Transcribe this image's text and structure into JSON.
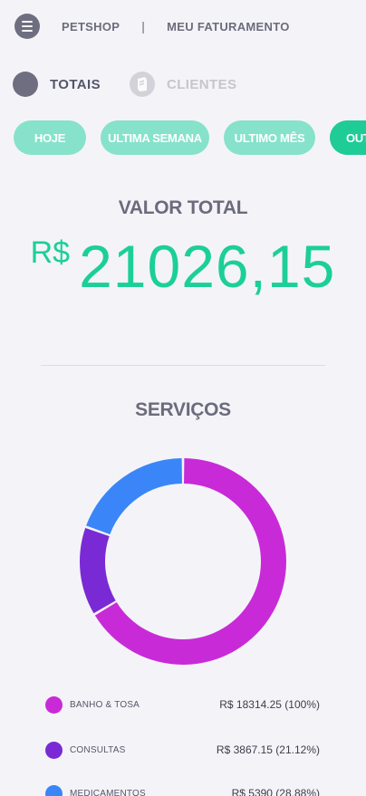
{
  "header": {
    "title": "PETSHOP",
    "separator": "|",
    "section": "MEU FATURAMENTO"
  },
  "view_toggle": {
    "active_label": "TOTAIS",
    "inactive_label": "CLIENTES"
  },
  "periods": [
    "HOJE",
    "ULTIMA SEMANA",
    "ULTIMO MÊS",
    "OUTROS"
  ],
  "total": {
    "title": "VALOR TOTAL",
    "currency": "R$",
    "amount": "21026,15"
  },
  "services": {
    "title": "SERVIÇOS"
  },
  "colors": {
    "accent": "#1ccf98",
    "chip": "#86e2cb",
    "chip_active": "#1fcc95"
  },
  "chart_data": {
    "type": "pie",
    "categories": [
      "BANHO & TOSA",
      "CONSULTAS",
      "MEDICAMENTOS"
    ],
    "values": [
      18314.25,
      3867.15,
      5390
    ],
    "colors": [
      "#c92ad8",
      "#7a2ad4",
      "#3a86f8"
    ],
    "legend": [
      {
        "label": "BANHO & TOSA",
        "value": "R$ 18314.25 (100%)"
      },
      {
        "label": "CONSULTAS",
        "value": "R$ 3867.15 (21.12%)"
      },
      {
        "label": "MEDICAMENTOS",
        "value": "R$ 5390 (28.88%)"
      }
    ]
  }
}
